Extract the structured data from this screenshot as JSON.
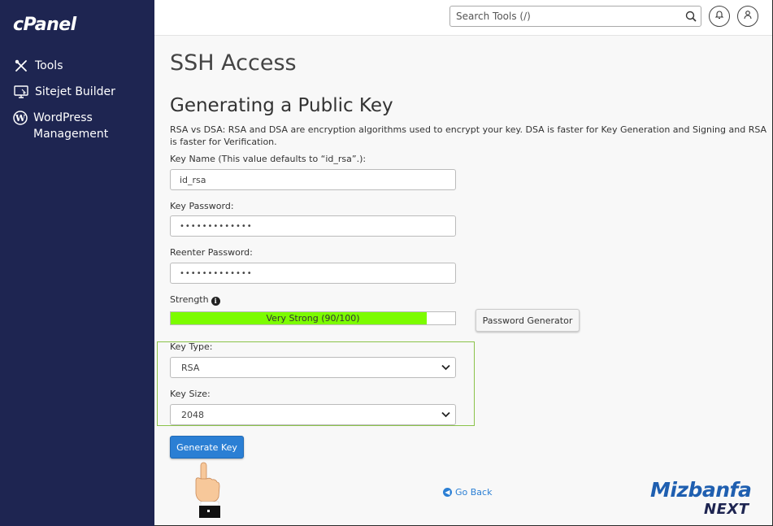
{
  "sidebar": {
    "logo": "cPanel",
    "items": [
      {
        "label": "Tools",
        "icon": "tools-icon"
      },
      {
        "label": "Sitejet Builder",
        "icon": "sitejet-icon"
      },
      {
        "label": "WordPress Management",
        "icon": "wordpress-icon"
      }
    ]
  },
  "header": {
    "search_placeholder": "Search Tools (/)"
  },
  "page": {
    "title": "SSH Access",
    "section_title": "Generating a Public Key",
    "description": "RSA vs DSA: RSA and DSA are encryption algorithms used to encrypt your key. DSA is faster for Key Generation and Signing and RSA is faster for Verification."
  },
  "form": {
    "key_name_label": "Key Name (This value defaults to “id_rsa”.):",
    "key_name_value": "id_rsa",
    "key_password_label": "Key Password:",
    "key_password_value": "•••••••••••••",
    "reenter_password_label": "Reenter Password:",
    "reenter_password_value": "•••••••••••••",
    "strength_label": "Strength",
    "strength_text": "Very Strong (90/100)",
    "strength_value": 90,
    "strength_max": 100,
    "password_generator_label": "Password Generator",
    "key_type_label": "Key Type:",
    "key_type_value": "RSA",
    "key_size_label": "Key Size:",
    "key_size_value": "2048",
    "generate_button_label": "Generate Key",
    "go_back_label": "Go Back"
  },
  "watermark": {
    "line1": "Mizbanfa",
    "line2": "NEXT"
  },
  "colors": {
    "sidebar_bg": "#1e2551",
    "strength_fill": "#7cfc00",
    "primary_button": "#2b7fd4",
    "highlight_box": "#8bc34a"
  }
}
